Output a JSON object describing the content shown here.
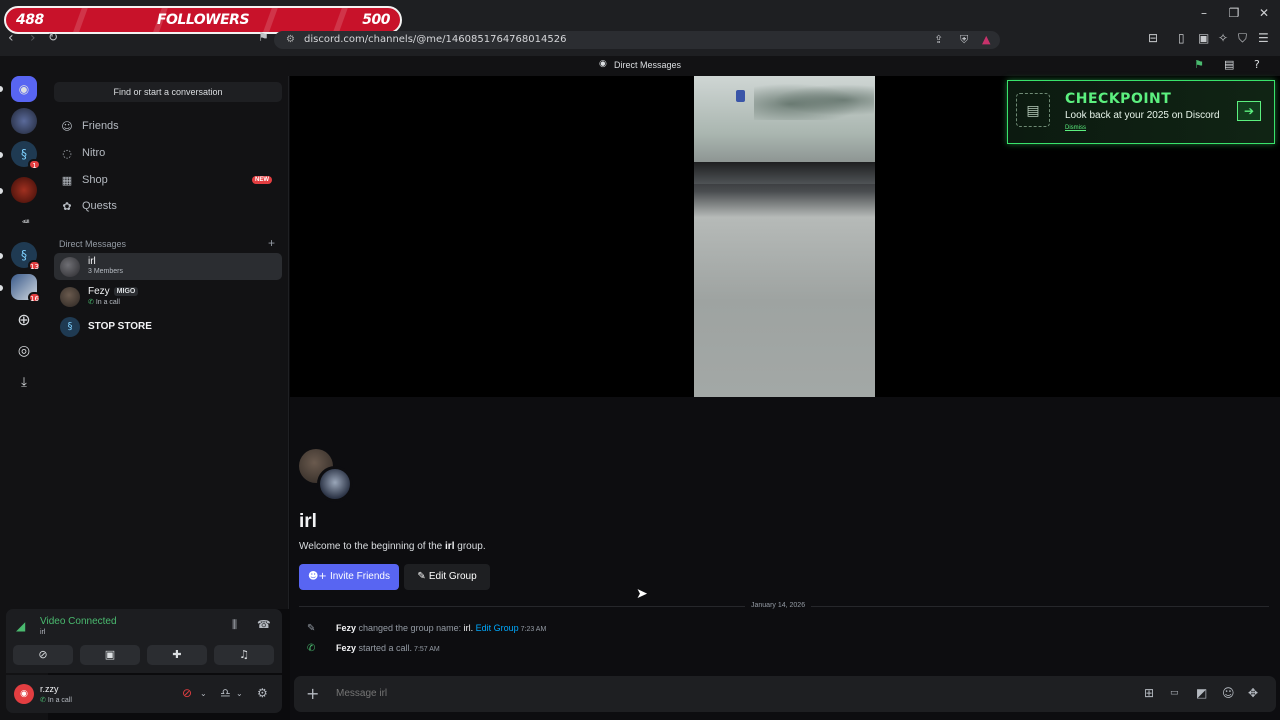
{
  "overlay": {
    "followers_current": "488",
    "followers_label": "FOLLOWERS",
    "followers_goal": "500"
  },
  "browser": {
    "url": "discord.com/channels/@me/1460851764768014526",
    "icons": {
      "back": "back-icon",
      "forward": "forward-icon",
      "reload": "reload-icon",
      "bookmark": "bookmark-icon"
    }
  },
  "topbar": {
    "title": "Direct Messages"
  },
  "servers": [
    {
      "name": "home",
      "badge": ""
    },
    {
      "name": "server-2",
      "badge": ""
    },
    {
      "name": "server-3",
      "badge": "1"
    },
    {
      "name": "server-4",
      "badge": ""
    },
    {
      "name": "server-5",
      "badge": ""
    },
    {
      "name": "server-6",
      "badge": "13"
    },
    {
      "name": "server-7",
      "badge": "16"
    }
  ],
  "sidebar": {
    "search_placeholder": "Find or start a conversation",
    "nav": [
      {
        "label": "Friends",
        "icon": "friends-icon"
      },
      {
        "label": "Nitro",
        "icon": "nitro-icon"
      },
      {
        "label": "Shop",
        "icon": "shop-icon",
        "badge": "NEW"
      },
      {
        "label": "Quests",
        "icon": "quests-icon"
      }
    ],
    "dm_header": "Direct Messages",
    "dms": [
      {
        "name": "irl",
        "sub": "3 Members"
      },
      {
        "name": "Fezy",
        "tag": "MIGO",
        "sub": "In a call"
      },
      {
        "name": "STOP STORE",
        "sub": ""
      }
    ]
  },
  "voice": {
    "status": "Video Connected",
    "channel": "irl"
  },
  "user": {
    "name": "r.zzy",
    "status": "In a call"
  },
  "banner": {
    "title": "CHECKPOINT",
    "subtitle": "Look back at your 2025 on Discord",
    "dismiss": "Dismiss"
  },
  "group": {
    "name": "irl",
    "welcome_prefix": "Welcome to the beginning of the ",
    "welcome_name": "irl",
    "welcome_suffix": " group.",
    "invite_label": "Invite Friends",
    "edit_label": "Edit Group"
  },
  "date_divider": "January 14, 2026",
  "messages": [
    {
      "who": "Fezy",
      "text": " changed the group name: ",
      "value": "irl.",
      "link": " Edit Group",
      "time": "7:23 AM"
    },
    {
      "who": "Fezy",
      "text": " started a call.",
      "value": "",
      "link": "",
      "time": "7:57 AM"
    }
  ],
  "composer": {
    "placeholder": "Message irl"
  },
  "colors": {
    "accent": "#5865f2",
    "green": "#4aba6f",
    "danger": "#e33e41",
    "checkpoint": "#5cf07f"
  }
}
